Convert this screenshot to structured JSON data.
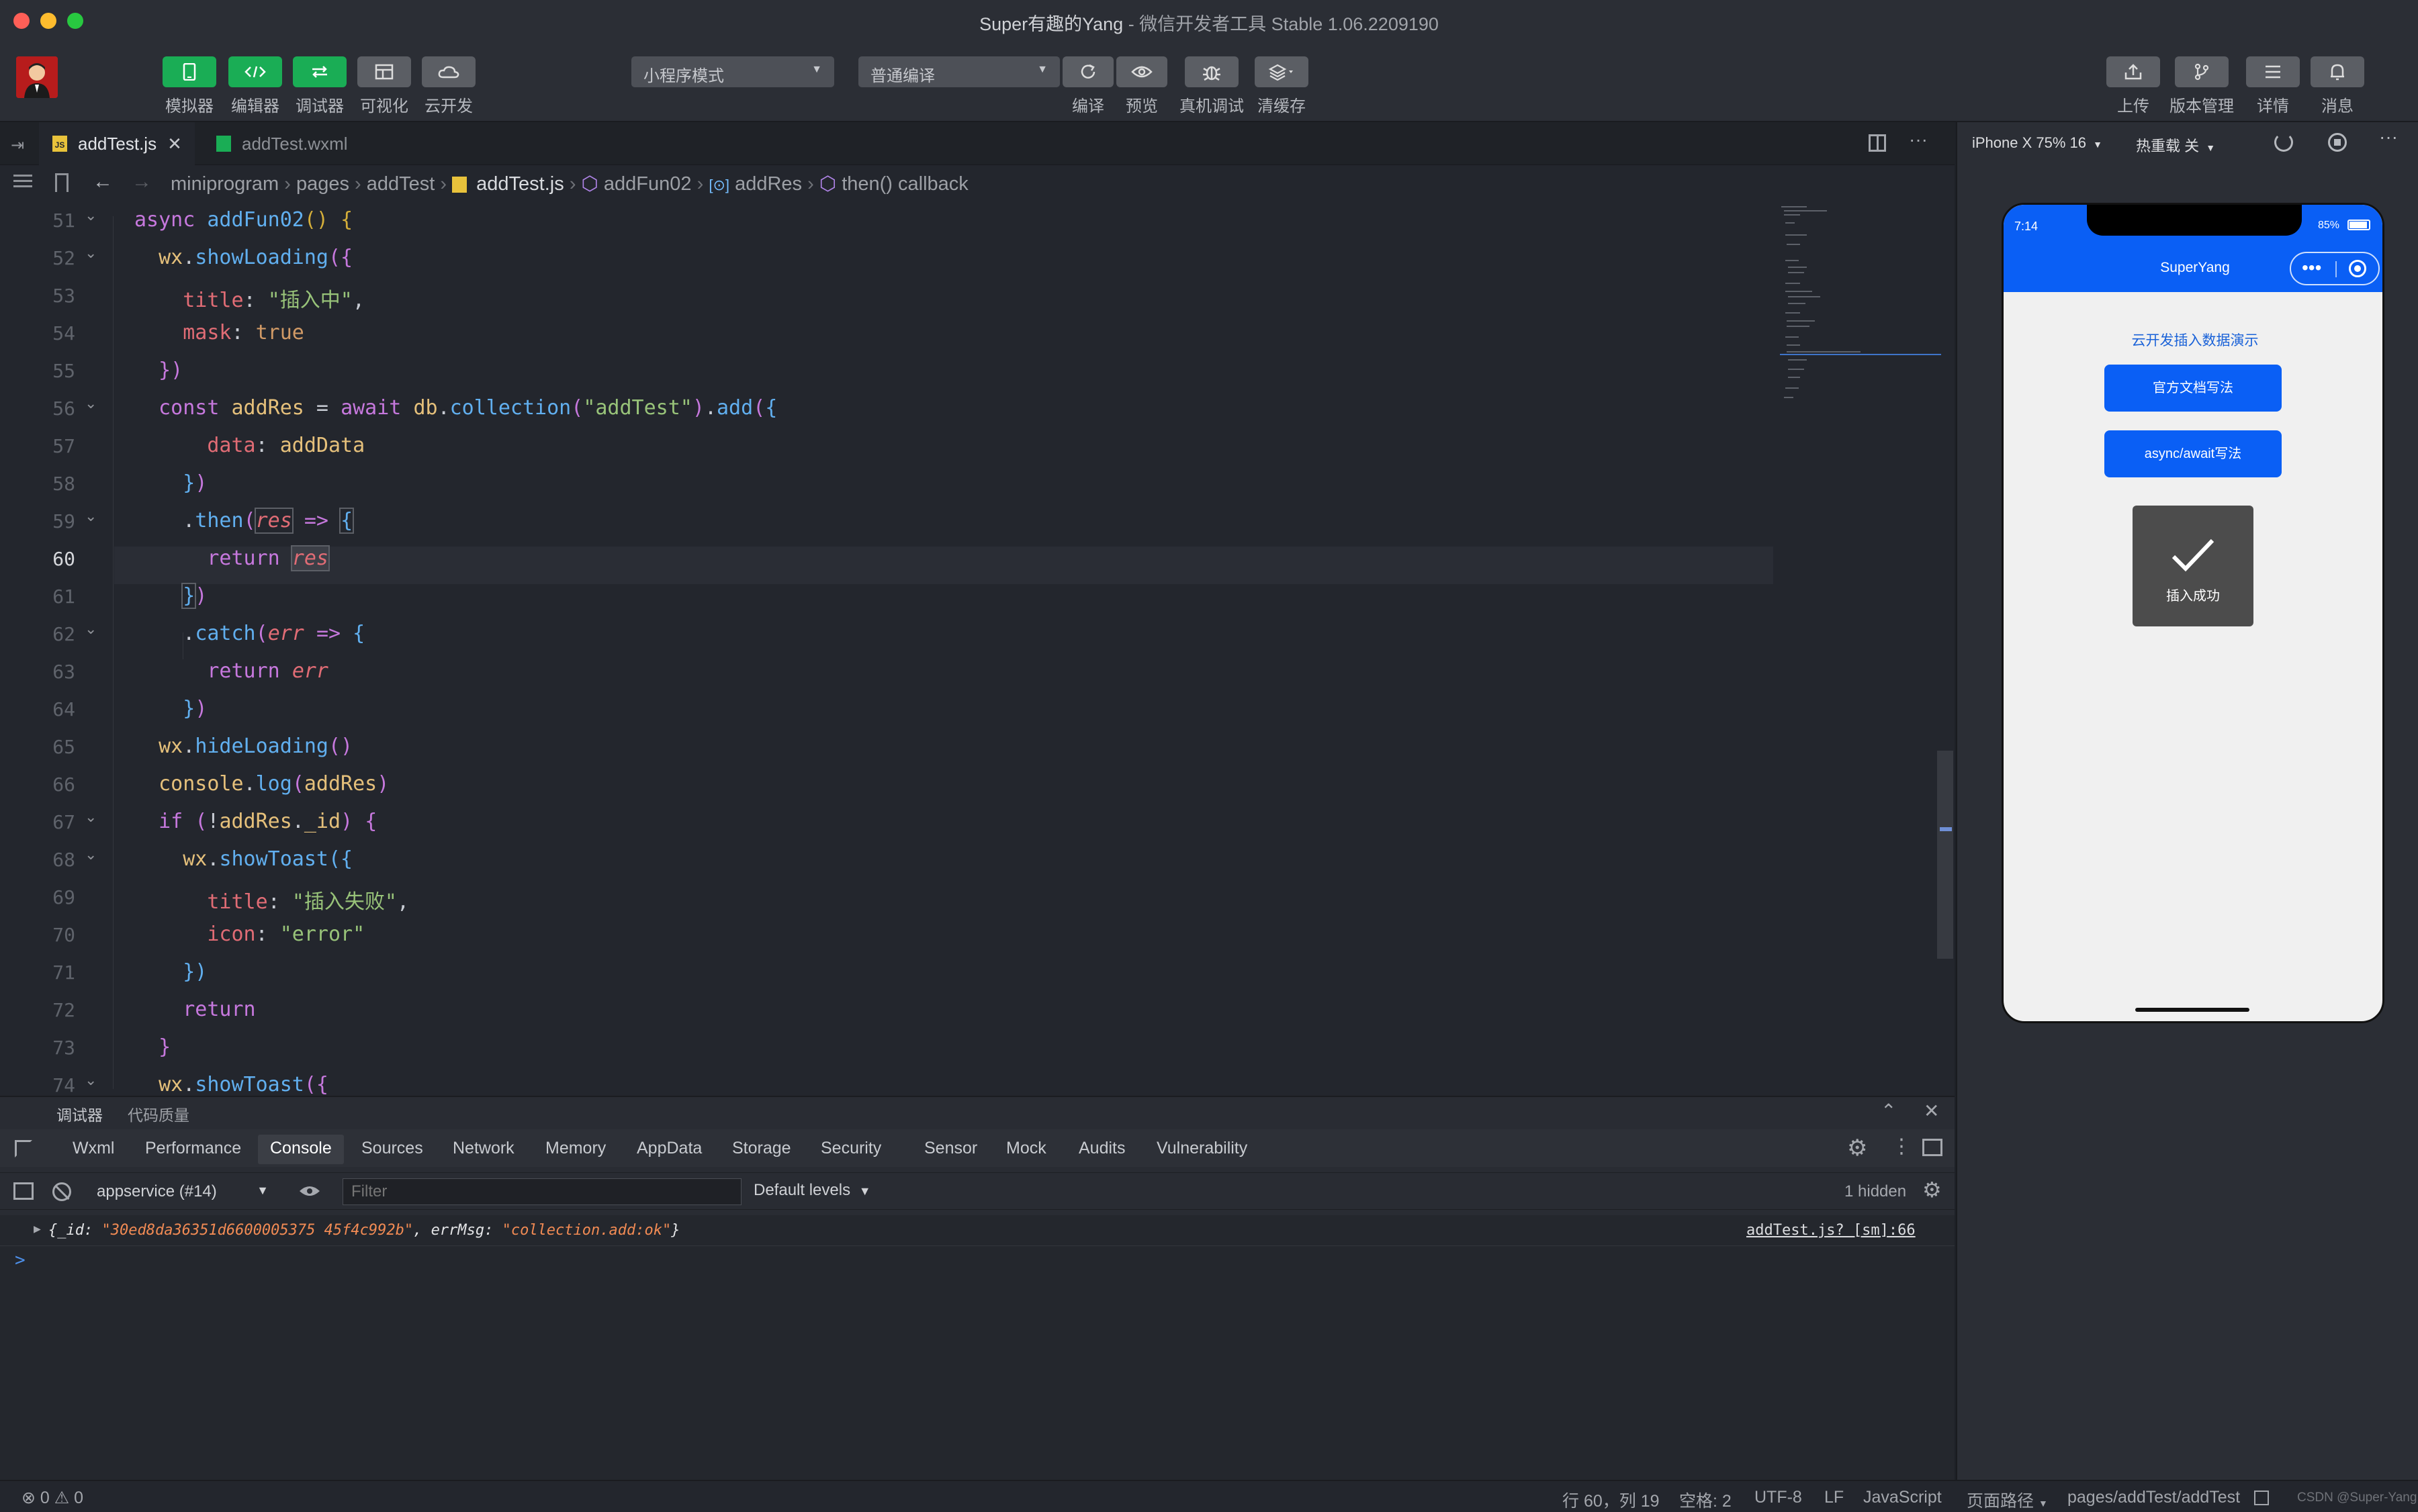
{
  "window": {
    "title": "Super有趣的Yang",
    "title_suffix": " - 微信开发者工具 Stable 1.06.2209190"
  },
  "toolbar": {
    "left_buttons": [
      "模拟器",
      "编辑器",
      "调试器",
      "可视化",
      "云开发"
    ],
    "mode_select": "小程序模式",
    "compile_select": "普通编译",
    "action_buttons": [
      "编译",
      "预览",
      "真机调试",
      "清缓存"
    ],
    "right_buttons": [
      "上传",
      "版本管理",
      "详情",
      "消息"
    ]
  },
  "editor": {
    "tabs": [
      {
        "label": "addTest.js",
        "active": true
      },
      {
        "label": "addTest.wxml",
        "active": false
      }
    ],
    "breadcrumb": [
      "miniprogram",
      "pages",
      "addTest",
      "addTest.js",
      "addFun02",
      "addRes",
      "then() callback"
    ],
    "line_numbers": [
      "51",
      "52",
      "53",
      "54",
      "55",
      "56",
      "57",
      "58",
      "59",
      "60",
      "61",
      "62",
      "63",
      "64",
      "65",
      "66",
      "67",
      "68",
      "69",
      "70",
      "71",
      "72",
      "73",
      "74"
    ],
    "current_line": "60"
  },
  "devtools": {
    "top_tabs": [
      "调试器",
      "代码质量"
    ],
    "tabs": [
      "Wxml",
      "Performance",
      "Console",
      "Sources",
      "Network",
      "Memory",
      "AppData",
      "Storage",
      "Security",
      "Sensor",
      "Mock",
      "Audits",
      "Vulnerability"
    ],
    "active_tab": "Console",
    "context_select": "appservice (#14)",
    "filter_placeholder": "Filter",
    "levels_select": "Default levels",
    "hidden_count": "1 hidden",
    "log_entry": {
      "id_key": "_id",
      "id_value": "\"30ed8da36351d6600005375 45f4c992b\"",
      "msg_key": "errMsg",
      "msg_value": "\"collection.add:ok\"",
      "source": "addTest.js? [sm]:66"
    },
    "prompt": ">"
  },
  "simulator": {
    "device_select": "iPhone X 75% 16",
    "hot_reload": "热重载 关",
    "phone": {
      "time": "7:14",
      "battery": "85%",
      "nav_title": "SuperYang",
      "page_heading": "云开发插入数据演示",
      "btn_official": "官方文档写法",
      "btn_async": "async/await写法",
      "toast_text": "插入成功"
    }
  },
  "statusbar": {
    "errors": "0",
    "warnings": "0",
    "position": "行 60，列 19",
    "spaces": "空格: 2",
    "encoding": "UTF-8",
    "eol": "LF",
    "language": "JavaScript",
    "page_path_label": "页面路径",
    "page_path": "pages/addTest/addTest",
    "watermark": "CSDN @Super-Yang"
  },
  "colors": {
    "accent_blue": "#0a5ff5",
    "green": "#1aad55",
    "bg": "#23262d"
  }
}
